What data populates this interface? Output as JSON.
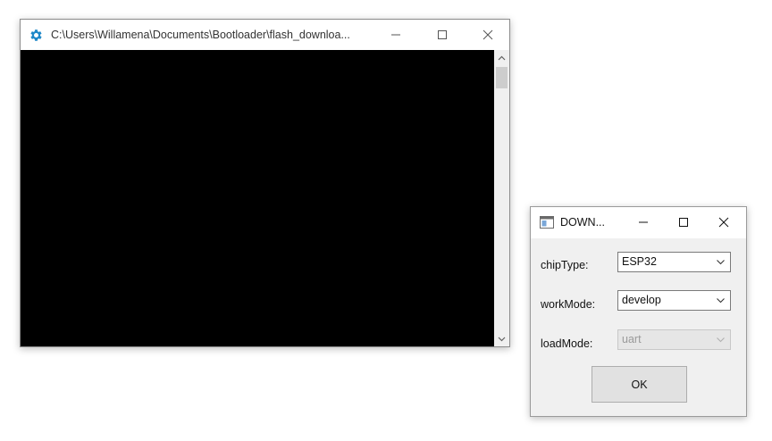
{
  "console_window": {
    "title": "C:\\Users\\Willamena\\Documents\\Bootloader\\flash_downloa...",
    "icon": "gear-icon",
    "accent_color": "#1e88c8",
    "background_color": "#000000"
  },
  "dialog": {
    "title": "DOWN...",
    "icon": "window-app-icon",
    "fields": [
      {
        "label": "chipType:",
        "value": "ESP32",
        "enabled": true
      },
      {
        "label": "workMode:",
        "value": "develop",
        "enabled": true
      },
      {
        "label": "loadMode:",
        "value": "uart",
        "enabled": false
      }
    ],
    "ok_label": "OK"
  }
}
